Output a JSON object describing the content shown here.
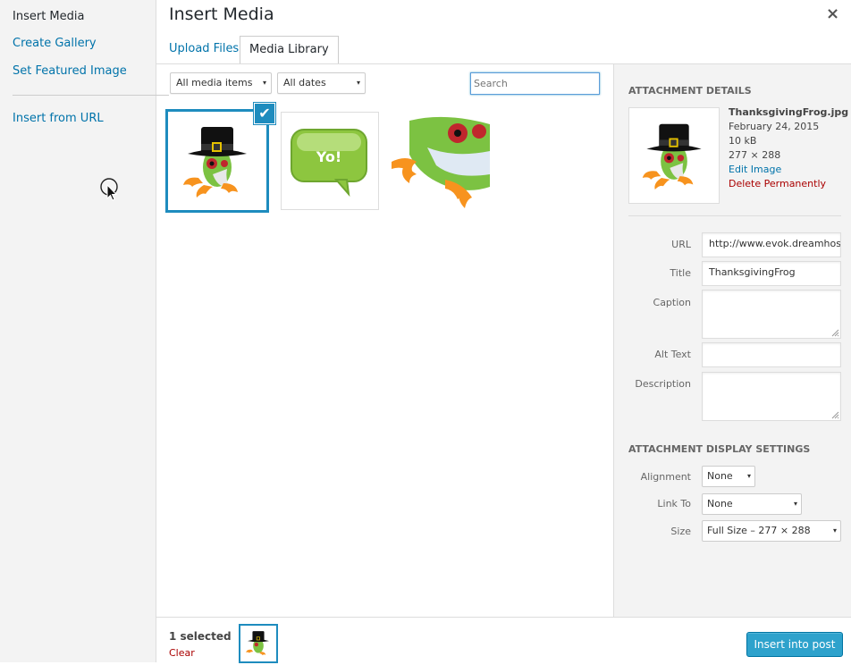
{
  "menu": {
    "insert_media": "Insert Media",
    "create_gallery": "Create Gallery",
    "set_featured": "Set Featured Image",
    "insert_from_url": "Insert from URL"
  },
  "header": {
    "title": "Insert Media",
    "close_glyph": "×"
  },
  "tabs": {
    "upload": "Upload Files",
    "library": "Media Library"
  },
  "toolbar": {
    "filter_type": "All media items",
    "filter_date": "All dates",
    "search_placeholder": "Search"
  },
  "attachments": [
    {
      "name": "thumbsgiving-frog",
      "selected": true,
      "icon": "frog-pilgrim-hat"
    },
    {
      "name": "yo-bubble",
      "selected": false,
      "icon": "yo-speech-bubble"
    },
    {
      "name": "tree-frog",
      "selected": false,
      "icon": "tree-frog"
    }
  ],
  "details": {
    "heading": "Attachment Details",
    "filename": "ThanksgivingFrog.jpg",
    "date": "February 24, 2015",
    "size": "10 kB",
    "dimensions": "277 × 288",
    "edit_link": "Edit Image",
    "delete_link": "Delete Permanently",
    "url_label": "URL",
    "url_value": "http://www.evok.dreamhost",
    "title_label": "Title",
    "title_value": "ThanksgivingFrog",
    "caption_label": "Caption",
    "alt_label": "Alt Text",
    "description_label": "Description"
  },
  "display": {
    "heading": "Attachment Display Settings",
    "alignment_label": "Alignment",
    "alignment_value": "None",
    "link_label": "Link To",
    "link_value": "None",
    "size_label": "Size",
    "size_value": "Full Size – 277 × 288"
  },
  "footer": {
    "selected_count": "1 selected",
    "clear": "Clear",
    "insert_button": "Insert into post"
  },
  "colors": {
    "accent": "#1e8cbe",
    "link": "#0073aa",
    "danger": "#a00",
    "primary_button": "#2ea2cc"
  }
}
